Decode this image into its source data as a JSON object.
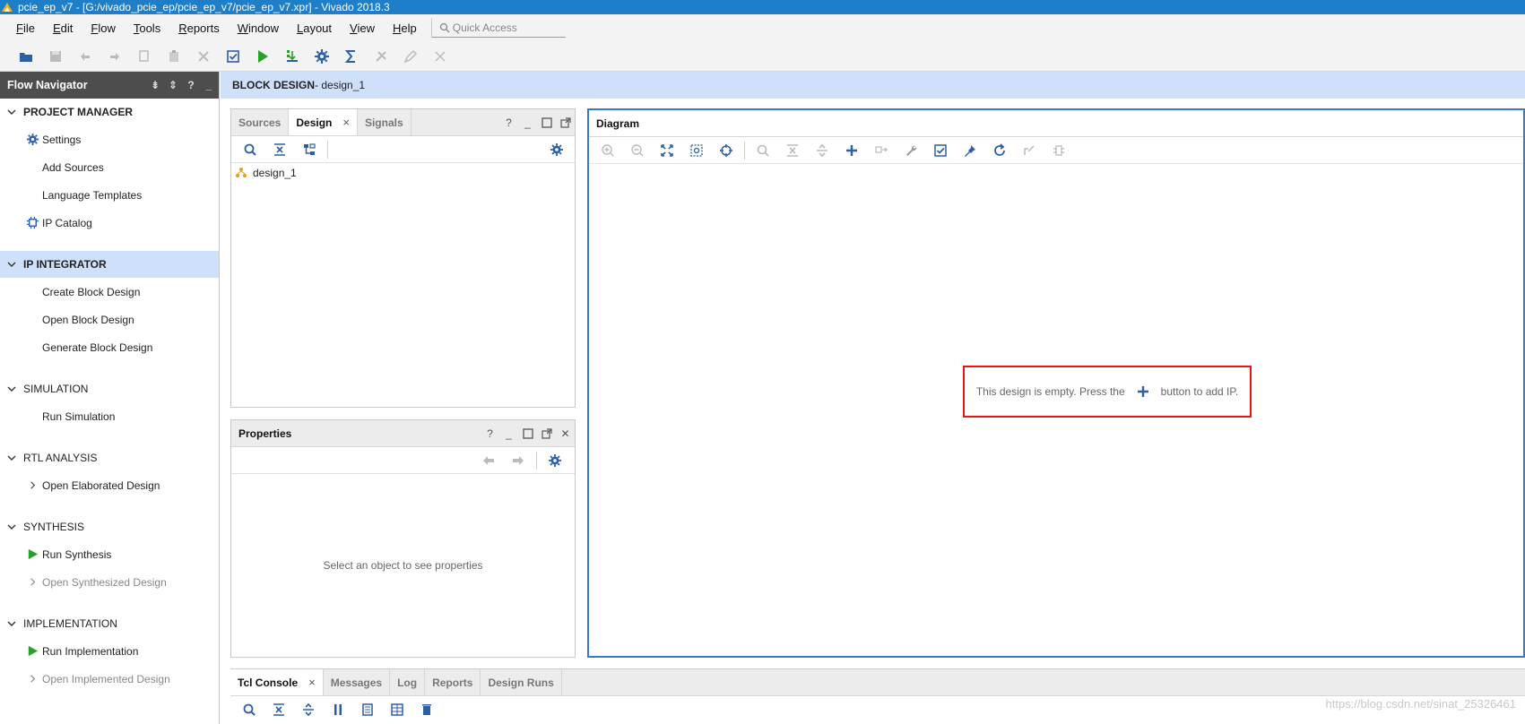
{
  "window": {
    "title": "pcie_ep_v7 - [G:/vivado_pcie_ep/pcie_ep_v7/pcie_ep_v7.xpr] - Vivado 2018.3"
  },
  "menu": {
    "items": [
      {
        "label": "File",
        "key": "F",
        "rest": "ile"
      },
      {
        "label": "Edit",
        "key": "E",
        "rest": "dit"
      },
      {
        "label": "Flow",
        "key": "F",
        "rest": "low"
      },
      {
        "label": "Tools",
        "key": "T",
        "rest": "ools"
      },
      {
        "label": "Reports",
        "key": "R",
        "rest": "eports"
      },
      {
        "label": "Window",
        "key": "W",
        "rest": "indow"
      },
      {
        "label": "Layout",
        "key": "L",
        "rest": "ayout"
      },
      {
        "label": "View",
        "key": "V",
        "rest": "iew"
      },
      {
        "label": "Help",
        "key": "H",
        "rest": "elp"
      }
    ],
    "quick_access_placeholder": "Quick Access"
  },
  "flow_navigator": {
    "title": "Flow Navigator",
    "sections": {
      "project_manager": "PROJECT MANAGER",
      "ip_integrator": "IP INTEGRATOR",
      "simulation": "SIMULATION",
      "rtl_analysis": "RTL ANALYSIS",
      "synthesis": "SYNTHESIS",
      "implementation": "IMPLEMENTATION"
    },
    "items": {
      "settings": "Settings",
      "add_sources": "Add Sources",
      "language_templates": "Language Templates",
      "ip_catalog": "IP Catalog",
      "create_block_design": "Create Block Design",
      "open_block_design": "Open Block Design",
      "generate_block_design": "Generate Block Design",
      "run_simulation": "Run Simulation",
      "open_elaborated_design": "Open Elaborated Design",
      "run_synthesis": "Run Synthesis",
      "open_synthesized_design": "Open Synthesized Design",
      "run_implementation": "Run Implementation",
      "open_implemented_design": "Open Implemented Design"
    }
  },
  "banner": {
    "bold": "BLOCK DESIGN",
    "rest": " - design_1"
  },
  "sources_panel": {
    "tabs": [
      "Sources",
      "Design",
      "Signals"
    ],
    "tree_item": "design_1"
  },
  "properties_panel": {
    "title": "Properties",
    "empty_message": "Select an object to see properties"
  },
  "diagram_panel": {
    "title": "Diagram",
    "empty_prefix": "This design is empty. Press the",
    "empty_suffix": "button to add IP."
  },
  "console": {
    "tabs": [
      "Tcl Console",
      "Messages",
      "Log",
      "Reports",
      "Design Runs"
    ]
  },
  "watermark": "https://blog.csdn.net/sinat_25326461",
  "colors": {
    "title_bar": "#1e7fc8",
    "selection": "#cfe0fb",
    "icon_blue": "#2b5fa6",
    "run_green": "#2aa02a",
    "highlight_red": "#e01818"
  }
}
